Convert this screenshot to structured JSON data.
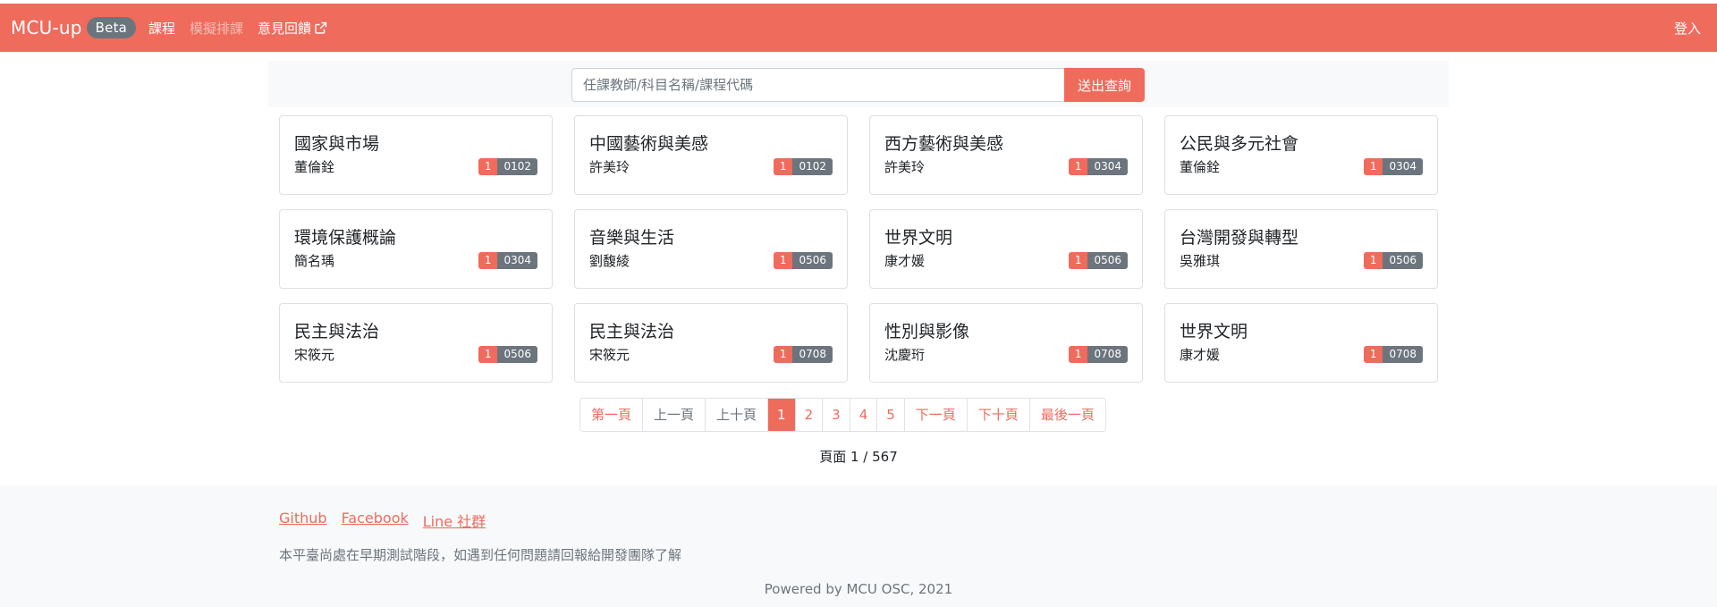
{
  "navbar": {
    "brand": "MCU-up",
    "badge": "Beta",
    "links": [
      {
        "label": "課程",
        "disabled": false
      },
      {
        "label": "模擬排課",
        "disabled": true
      },
      {
        "label": "意見回饋",
        "disabled": false
      }
    ],
    "login": "登入"
  },
  "search": {
    "placeholder": "任課教師/科目名稱/課程代碼",
    "button": "送出查詢"
  },
  "courses": [
    {
      "title": "國家與市場",
      "teacher": "董倫銓",
      "grade": "1",
      "time": "0102"
    },
    {
      "title": "中國藝術與美感",
      "teacher": "許美玲",
      "grade": "1",
      "time": "0102"
    },
    {
      "title": "西方藝術與美感",
      "teacher": "許美玲",
      "grade": "1",
      "time": "0304"
    },
    {
      "title": "公民與多元社會",
      "teacher": "董倫銓",
      "grade": "1",
      "time": "0304"
    },
    {
      "title": "環境保護概論",
      "teacher": "簡名瑀",
      "grade": "1",
      "time": "0304"
    },
    {
      "title": "音樂與生活",
      "teacher": "劉馥綾",
      "grade": "1",
      "time": "0506"
    },
    {
      "title": "世界文明",
      "teacher": "康才媛",
      "grade": "1",
      "time": "0506"
    },
    {
      "title": "台灣開發與轉型",
      "teacher": "吳雅琪",
      "grade": "1",
      "time": "0506"
    },
    {
      "title": "民主與法治",
      "teacher": "宋筱元",
      "grade": "1",
      "time": "0506"
    },
    {
      "title": "民主與法治",
      "teacher": "宋筱元",
      "grade": "1",
      "time": "0708"
    },
    {
      "title": "性別與影像",
      "teacher": "沈慶珩",
      "grade": "1",
      "time": "0708"
    },
    {
      "title": "世界文明",
      "teacher": "康才媛",
      "grade": "1",
      "time": "0708"
    }
  ],
  "pagination": {
    "first": "第一頁",
    "prev": "上一頁",
    "prev10": "上十頁",
    "pages": [
      "1",
      "2",
      "3",
      "4",
      "5"
    ],
    "next": "下一頁",
    "next10": "下十頁",
    "last": "最後一頁",
    "info": "頁面 1 / 567"
  },
  "footer": {
    "links": [
      "Github",
      "Facebook",
      "Line 社群"
    ],
    "note": "本平臺尚處在早期測試階段，如遇到任何問題請回報給開發團隊了解",
    "powered": "Powered by MCU OSC, 2021"
  },
  "colors": {
    "accent": "#ef6b5c",
    "badge": "#6c757d"
  }
}
